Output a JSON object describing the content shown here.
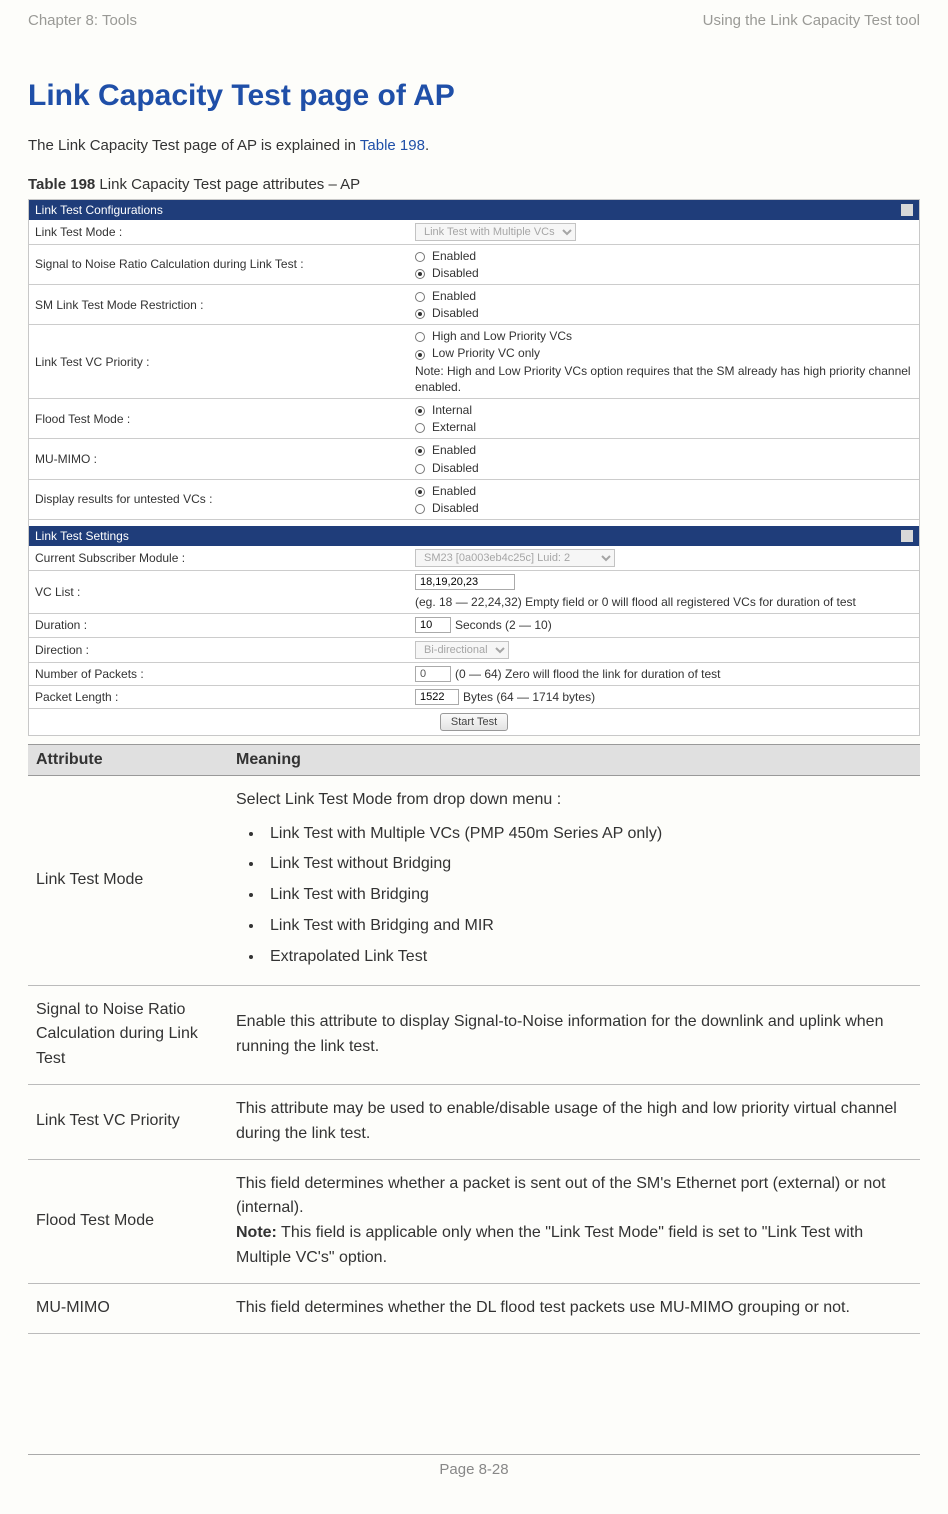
{
  "header": {
    "left": "Chapter 8:  Tools",
    "right": "Using the Link Capacity Test tool"
  },
  "title": "Link Capacity Test page of AP",
  "intro_pre": "The Link Capacity Test page of AP is explained in ",
  "intro_link": "Table 198",
  "intro_post": ".",
  "caption_bold": "Table 198",
  "caption_rest": " Link Capacity Test page attributes – AP",
  "panel1_title": "Link Test Configurations",
  "panel2_title": "Link Test Settings",
  "config": {
    "link_test_mode_label": "Link Test Mode :",
    "link_test_mode_value": "Link Test with Multiple VCs",
    "snr_label": "Signal to Noise Ratio Calculation during Link Test :",
    "sm_restrict_label": "SM Link Test Mode Restriction :",
    "vc_priority_label": "Link Test VC Priority :",
    "vc_priority_opt1": "High and Low Priority VCs",
    "vc_priority_opt2": "Low Priority VC only",
    "vc_priority_note": "Note: High and Low Priority VCs option requires that the SM already has high priority channel enabled.",
    "flood_label": "Flood Test Mode :",
    "flood_opt1": "Internal",
    "flood_opt2": "External",
    "mumimo_label": "MU-MIMO :",
    "display_label": "Display results for untested VCs :",
    "enabled": "Enabled",
    "disabled": "Disabled"
  },
  "settings": {
    "csm_label": "Current Subscriber Module :",
    "csm_value": "SM23 [0a003eb4c25c] Luid: 2",
    "vclist_label": "VC List :",
    "vclist_value": "18,19,20,23",
    "vclist_hint": "(eg. 18 — 22,24,32) Empty field or 0 will flood all registered VCs for duration of test",
    "duration_label": "Duration :",
    "duration_value": "10",
    "duration_hint": "Seconds (2 — 10)",
    "direction_label": "Direction :",
    "direction_value": "Bi-directional",
    "numpackets_label": "Number of Packets :",
    "numpackets_value": "0",
    "numpackets_hint": "(0 — 64) Zero will flood the link for duration of test",
    "pktlen_label": "Packet Length :",
    "pktlen_value": "1522",
    "pktlen_hint": "Bytes (64 — 1714 bytes)",
    "start_btn": "Start Test"
  },
  "table": {
    "col1": "Attribute",
    "col2": "Meaning",
    "rows": [
      {
        "attr": "Link Test Mode",
        "lead": "Select Link Test Mode from drop down menu :",
        "bullets": [
          "Link Test with Multiple VCs (PMP 450m Series AP only)",
          "Link Test without Bridging",
          "Link Test with Bridging",
          "Link Test with Bridging and MIR",
          "Extrapolated Link Test"
        ]
      },
      {
        "attr": "Signal to Noise Ratio Calculation during Link Test",
        "text": "Enable this attribute to display Signal-to-Noise information for the downlink and uplink when running the link test."
      },
      {
        "attr": "Link Test VC Priority",
        "text": "This attribute may be used to enable/disable usage of the high and low priority virtual channel during the link test."
      },
      {
        "attr": "Flood Test Mode",
        "text": "This field determines whether a packet is sent out of the SM's Ethernet port (external)  or not (internal).",
        "note_label": "Note:",
        "note_text": " This field is applicable only when the \"Link Test Mode\" field is set to \"Link Test with Multiple VC's\" option."
      },
      {
        "attr": "MU-MIMO",
        "text": "This field determines whether the DL flood test packets use MU-MIMO grouping or not."
      }
    ]
  },
  "footer": "Page 8-28"
}
